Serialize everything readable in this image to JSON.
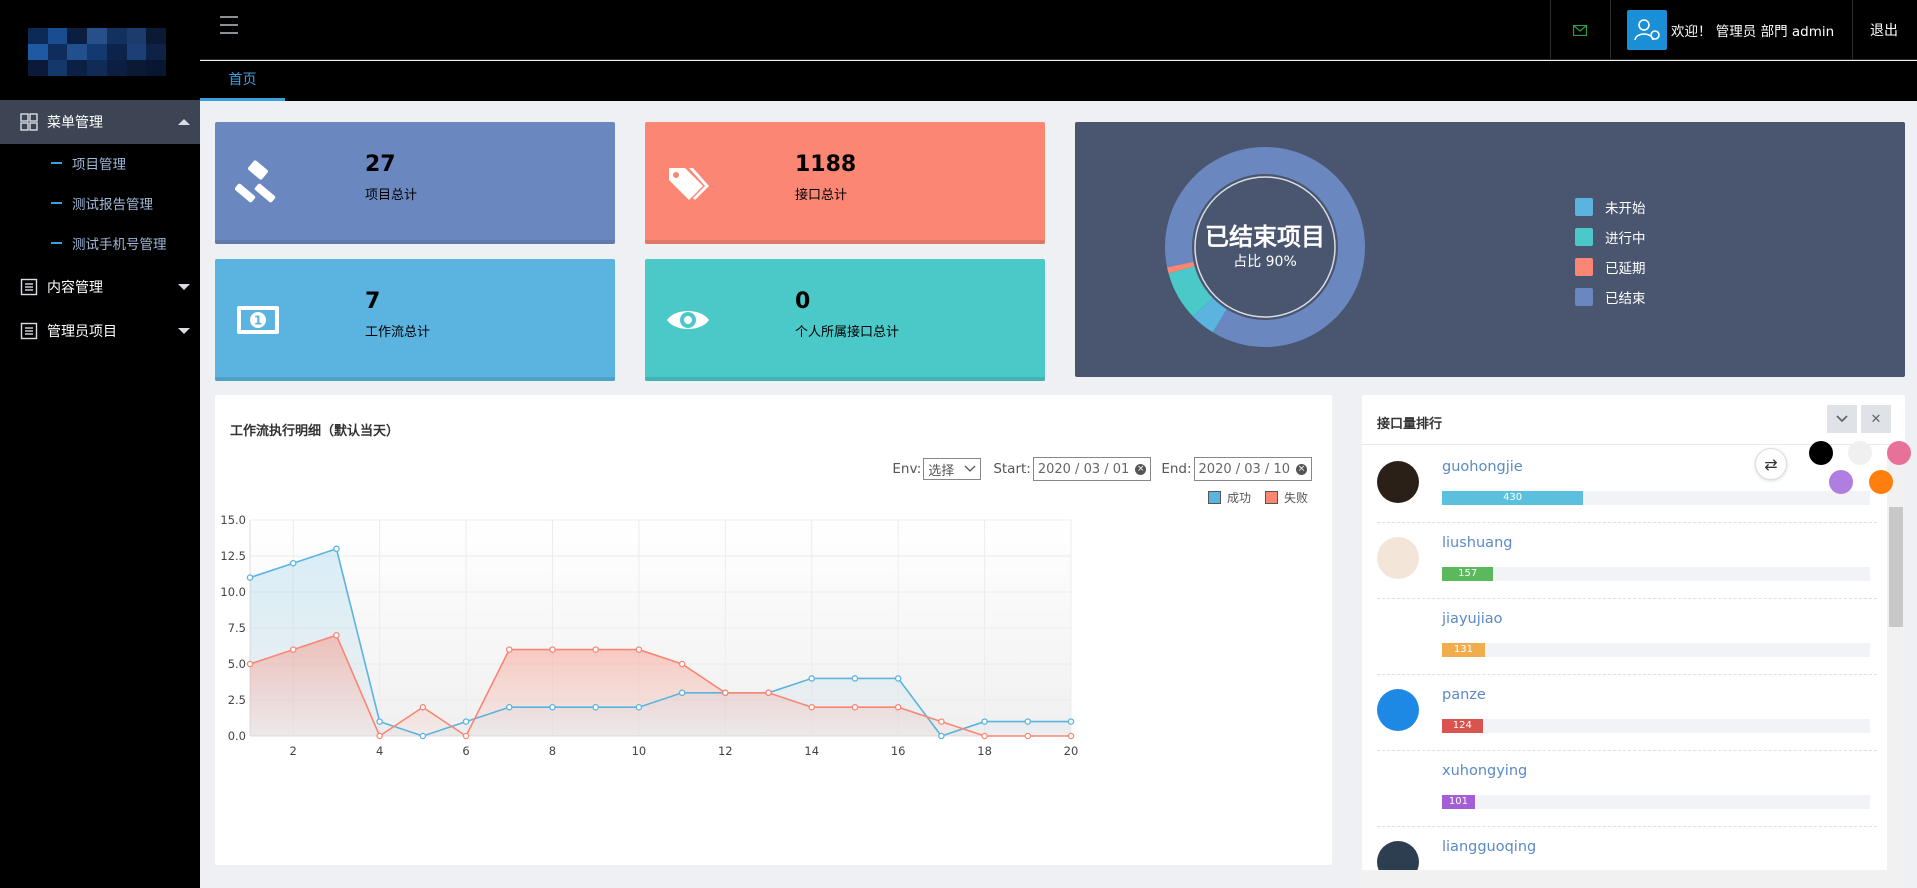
{
  "header": {
    "welcome": "欢迎！ 管理员 部門 admin",
    "logout": "退出"
  },
  "tabs": {
    "home": "首页"
  },
  "sidebar": {
    "menu_management": "菜单管理",
    "sub_items": [
      "项目管理",
      "测试报告管理",
      "测试手机号管理"
    ],
    "content_management": "内容管理",
    "admin_projects": "管理员项目"
  },
  "cards": {
    "projects": {
      "value": "27",
      "label": "项目总计",
      "color": "#6a88bf",
      "icon": "gavel-icon"
    },
    "apis": {
      "value": "1188",
      "label": "接口总计",
      "color": "#fa8673",
      "icon": "tags-icon"
    },
    "workflows": {
      "value": "7",
      "label": "工作流总计",
      "color": "#5ab4df",
      "icon": "money-icon"
    },
    "personal": {
      "value": "0",
      "label": "个人所属接口总计",
      "color": "#4bc8c8",
      "icon": "eye-icon"
    }
  },
  "donut": {
    "center_title": "已结束项目",
    "center_sub": "占比 90%",
    "slices": [
      {
        "name": "未开始",
        "share": 0.04,
        "color": "#5ab4df"
      },
      {
        "name": "进行中",
        "share": 0.08,
        "color": "#4bc8c8"
      },
      {
        "name": "已延期",
        "share": 0.01,
        "color": "#fa8673"
      },
      {
        "name": "已结束",
        "share": 0.87,
        "color": "#6a88bf"
      }
    ]
  },
  "workflow_chart": {
    "title": "工作流执行明细（默认当天）",
    "env_label": "Env:",
    "env_value": "选择",
    "start_label": "Start:",
    "start_value": "2020 / 03 / 01",
    "end_label": "End:",
    "end_value": "2020 / 03 / 10"
  },
  "chart_data": {
    "type": "line",
    "x": [
      1,
      2,
      3,
      4,
      5,
      6,
      7,
      8,
      9,
      10,
      11,
      12,
      13,
      14,
      15,
      16,
      17,
      18,
      19,
      20
    ],
    "x_ticks": [
      "2",
      "4",
      "6",
      "8",
      "10",
      "12",
      "14",
      "16",
      "18",
      "20"
    ],
    "y_ticks": [
      "0.0",
      "2.5",
      "5.0",
      "7.5",
      "10.0",
      "12.5",
      "15.0"
    ],
    "ylim": [
      0,
      15
    ],
    "series": [
      {
        "name": "成功",
        "color": "#5ab4df",
        "values": [
          11,
          12,
          13,
          1,
          0,
          1,
          2,
          2,
          2,
          2,
          3,
          3,
          3,
          4,
          4,
          4,
          0,
          1,
          1,
          1
        ]
      },
      {
        "name": "失败",
        "color": "#fa8673",
        "values": [
          5,
          6,
          7,
          0,
          2,
          0,
          6,
          6,
          6,
          6,
          5,
          3,
          3,
          2,
          2,
          2,
          1,
          0,
          0,
          0
        ]
      }
    ],
    "legend": "top-right",
    "grid": true
  },
  "ranking": {
    "title": "接口量排行",
    "items": [
      {
        "name": "guohongjie",
        "value": "430",
        "ratio": 0.33,
        "color": "#5bc0de"
      },
      {
        "name": "liushuang",
        "value": "157",
        "ratio": 0.12,
        "color": "#5cb85c"
      },
      {
        "name": "jiayujiao",
        "value": "131",
        "ratio": 0.1,
        "color": "#f0ad4e"
      },
      {
        "name": "panze",
        "value": "124",
        "ratio": 0.095,
        "color": "#d9534f"
      },
      {
        "name": "xuhongying",
        "value": "101",
        "ratio": 0.077,
        "color": "#a55fd6"
      },
      {
        "name": "liangguoqing",
        "value": "",
        "ratio": 0.0,
        "color": "#5bc0de"
      }
    ]
  },
  "theme_colors": [
    "#000000",
    "#f0f0f0",
    "#e8719a",
    "#b07ee0",
    "#ff7f0e"
  ]
}
